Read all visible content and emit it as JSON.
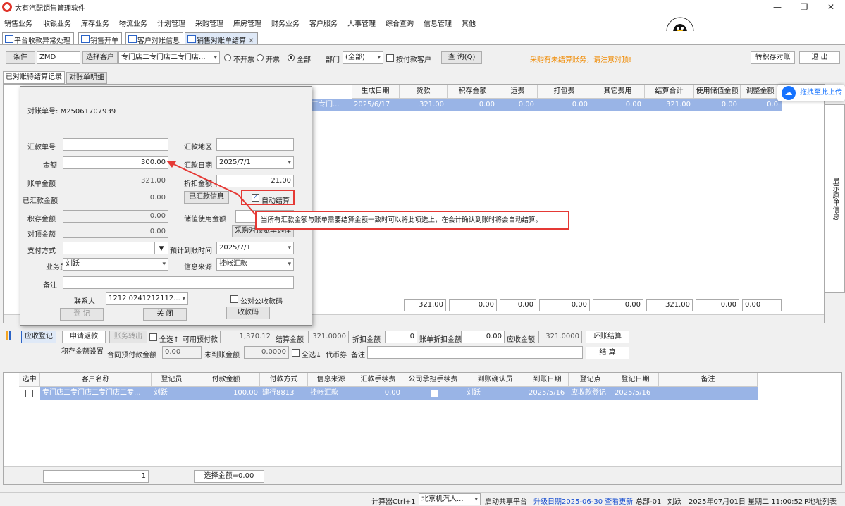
{
  "app": {
    "title": "大有汽配销售管理软件"
  },
  "menu": [
    "销售业务",
    "收银业务",
    "库存业务",
    "物流业务",
    "计划管理",
    "采购管理",
    "库房管理",
    "财务业务",
    "客户服务",
    "人事管理",
    "综合查询",
    "信息管理",
    "其他"
  ],
  "tabs": [
    "平台收款异常处理",
    "销售开单",
    "客户对账信息",
    "销售对账单结算"
  ],
  "toolbar": {
    "condition": "条件",
    "condition_value": "ZMD",
    "select_customer": "选择客户",
    "customer": "专门店二专门店二专门店...",
    "radio_no_invoice": "不开票",
    "radio_invoice": "开票",
    "radio_all": "全部",
    "dept_label": "部门",
    "dept_value": "(全部)",
    "by_payer": "按付款客户",
    "query": "查 询(Q)",
    "warning": "采购有未结算账务，请注意对顶!",
    "transfer": "转积存对账",
    "exit": "退 出"
  },
  "subtabs": [
    "已对账待结算记录",
    "对账单明细"
  ],
  "top_grid": {
    "headers": [
      "生成日期",
      "货款",
      "积存金额",
      "运费",
      "打包费",
      "其它费用",
      "结算合计",
      "使用储值金额",
      "调整金额"
    ],
    "row": {
      "customer": "二专门...",
      "date": "2025/6/17",
      "goods": "321.00",
      "stored": "0.00",
      "freight": "0.00",
      "pack": "0.00",
      "other": "0.00",
      "total": "321.00",
      "stored_use": "0.00",
      "adjust": "0.0"
    },
    "totals": [
      "321.00",
      "0.00",
      "0.00",
      "0.00",
      "0.00",
      "321.00",
      "0.00",
      "0.00"
    ]
  },
  "side_panel": "显示原单信息",
  "drag_upload": "拖拽至此上传",
  "dialog": {
    "bill_no_label": "对账单号:",
    "bill_no": "M25061707939",
    "remit_no": "汇款单号",
    "remit_area": "汇款地区",
    "amount_label": "金额",
    "amount": "300.00",
    "remit_date_label": "汇款日期",
    "remit_date": "2025/7/1",
    "bill_amount_label": "账单金额",
    "bill_amount": "321.00",
    "discount_label": "折扣金额",
    "discount": "21.00",
    "remitted_label": "已汇款金额",
    "remitted": "0.00",
    "remitted_info": "已汇款信息",
    "auto_settle": "自动结算",
    "stored_label": "积存金额",
    "stored": "0.00",
    "stored_use_label": "储值使用金额",
    "offset_label": "对顶金额",
    "offset": "0.00",
    "purchase_btn": "采购对顶账单选择",
    "pay_method_label": "支付方式",
    "expected_label": "预计到账时间",
    "expected": "2025/7/1",
    "salesman_label": "业务员",
    "salesman": "刘跃",
    "source_label": "信息来源",
    "source": "挂帐汇款",
    "remark_label": "备注",
    "contact_label": "联系人",
    "contact": "1212 0241212112...",
    "public_account": "公对公收款码",
    "register": "登 记",
    "close": "关 闭",
    "qr": "收款码"
  },
  "tooltip": "当所有汇款金额与账单需要结算金额一致时可以将此项选上，在会计确认到账时将会自动结算。",
  "midbar": {
    "receivable_reg": "应收登记",
    "apply_rebate": "申请返款",
    "transfer_out": "账务转出",
    "select_all_up": "全选↑",
    "prepay_label": "可用预付款",
    "prepay": "1,370.12",
    "settle_label": "结算金额",
    "settle": "321.0000",
    "discount_label": "折扣金额",
    "discount": "0",
    "bill_discount_label": "账单折扣金额",
    "bill_discount": "0.00",
    "receivable_label": "应收金额",
    "receivable": "321.0000",
    "ring_settle": "环账结算",
    "stored_setting": "积存金额设置",
    "contract_label": "合同预付款金额",
    "contract": "0.00",
    "unpaid_label": "未到账金额",
    "unpaid": "0.0000",
    "select_all_down": "全选↓",
    "currency": "代币券",
    "remark": "备注",
    "settle_btn": "结 算"
  },
  "bottom_grid": {
    "headers": [
      "选中",
      "客户名称",
      "登记员",
      "付款金额",
      "付款方式",
      "信息来源",
      "汇款手续费",
      "公司承担手续费",
      "到账确认员",
      "到账日期",
      "登记点",
      "登记日期",
      "备注"
    ],
    "row": {
      "customer": "专门店二专门店二专门店二专...",
      "clerk": "刘跃",
      "amount": "100.00",
      "method": "建行8813",
      "source": "挂帐汇款",
      "fee": "0.00",
      "confirmer": "刘跃",
      "date": "2025/5/16",
      "point": "应收款登记",
      "reg_date": "2025/5/16"
    },
    "footer_count": "1",
    "footer_sum": "选择金额=0.00"
  },
  "status": {
    "calc": "计算器Ctrl+1",
    "city": "北京机汽人...",
    "share": "启动共享平台",
    "upgrade": "升级日期2025-06-30 查看更新",
    "dept": "总部-01",
    "user": "刘跃",
    "datetime": "2025年07月01日 星期二 11:00:52",
    "ip": "IP地址列表"
  }
}
